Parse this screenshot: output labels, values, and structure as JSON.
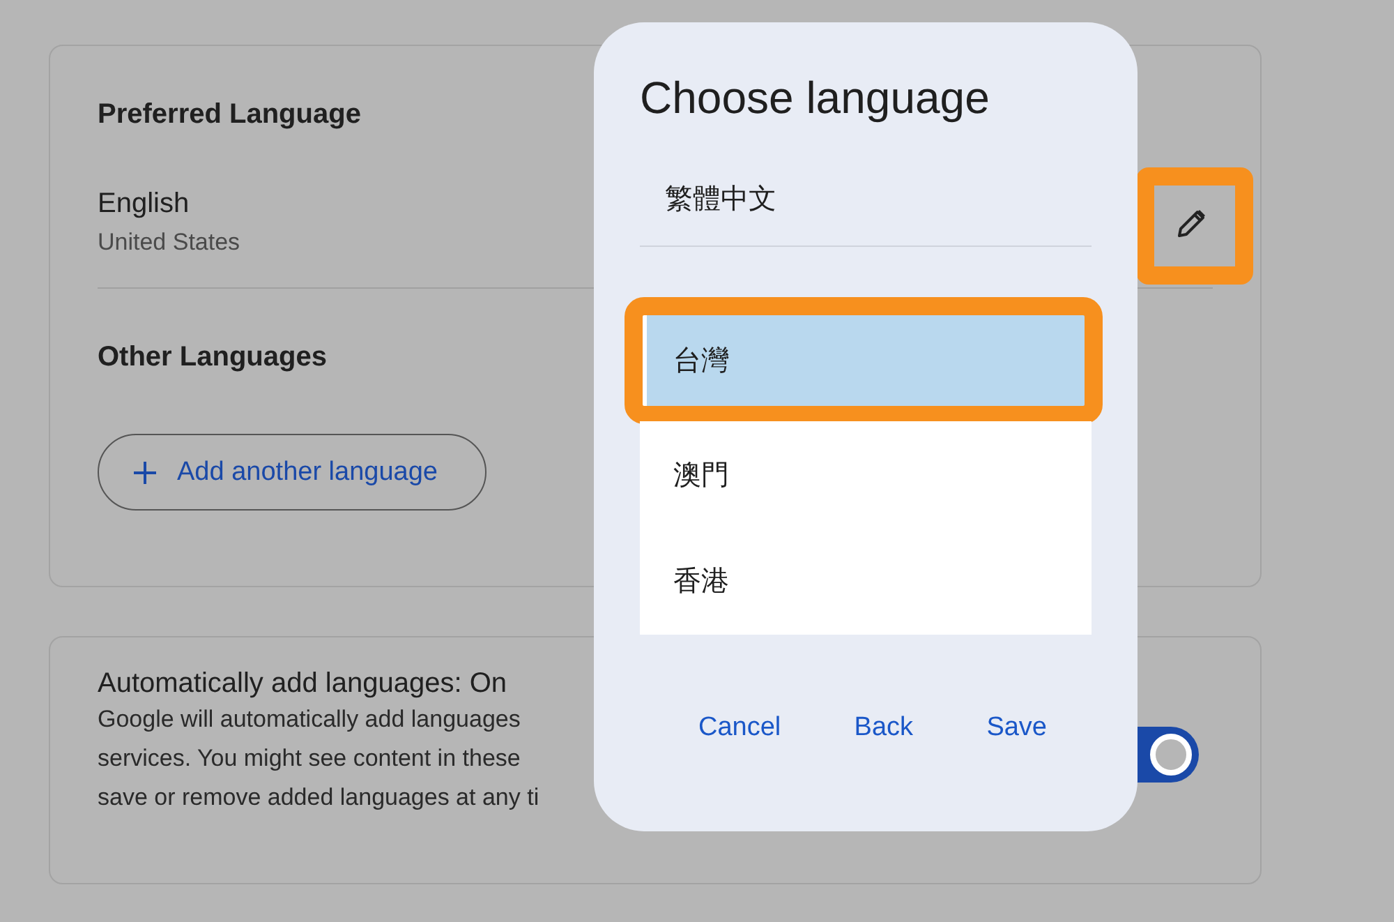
{
  "preferred_language": {
    "heading": "Preferred Language",
    "language": "English",
    "region": "United States",
    "edit_button": {
      "highlighted": true
    }
  },
  "other_languages": {
    "heading": "Other Languages",
    "add_button": {
      "label": "Add another language"
    }
  },
  "auto_add": {
    "title": "Automatically add languages: On",
    "description_lines": [
      "Google will automatically add languages",
      "services. You might see content in these",
      "save or remove added languages at any ti"
    ],
    "toggle": {
      "on": true
    }
  },
  "dialog": {
    "title": "Choose language",
    "current": "繁體中文",
    "options": [
      {
        "label": "台灣",
        "selected": true,
        "highlighted": true
      },
      {
        "label": "澳門",
        "selected": false,
        "highlighted": false
      },
      {
        "label": "香港",
        "selected": false,
        "highlighted": false
      }
    ],
    "buttons": [
      "Cancel",
      "Back",
      "Save"
    ]
  }
}
